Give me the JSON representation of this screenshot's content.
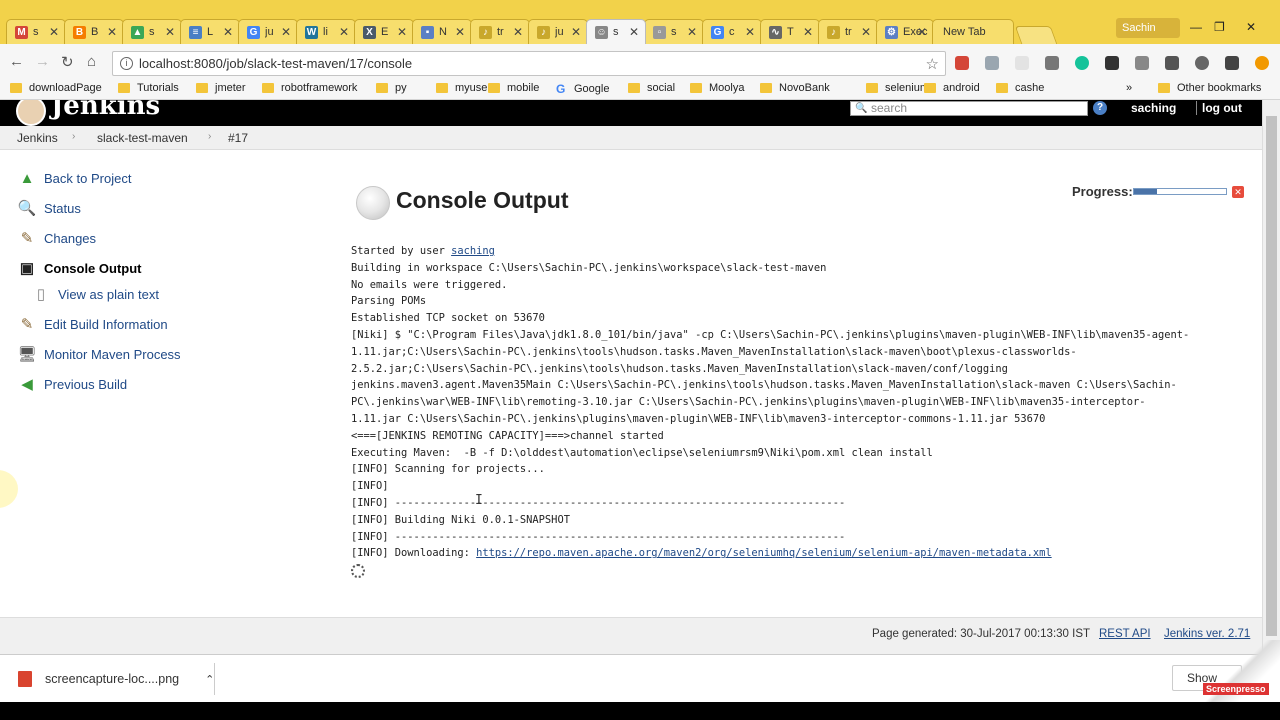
{
  "browser": {
    "tabs": [
      {
        "label": "s",
        "color": "#d44638",
        "glyph": "M"
      },
      {
        "label": "B",
        "color": "#f57d00",
        "glyph": "B"
      },
      {
        "label": "s",
        "color": "#3aa757",
        "glyph": "▲"
      },
      {
        "label": "L",
        "color": "#4a7fc4",
        "glyph": "≡"
      },
      {
        "label": "ju",
        "color": "#4285f4",
        "glyph": "G"
      },
      {
        "label": "li",
        "color": "#21759b",
        "glyph": "W"
      },
      {
        "label": "E",
        "color": "#4a5a6a",
        "glyph": "X"
      },
      {
        "label": "N",
        "color": "#5b7fc4",
        "glyph": "▪"
      },
      {
        "label": "tr",
        "color": "#c9a82c",
        "glyph": "♪"
      },
      {
        "label": "ju",
        "color": "#c9a82c",
        "glyph": "♪"
      },
      {
        "label": "s",
        "color": "#888888",
        "glyph": "☺"
      },
      {
        "label": "s",
        "color": "#999999",
        "glyph": "▫"
      },
      {
        "label": "c",
        "color": "#4285f4",
        "glyph": "G"
      },
      {
        "label": "T",
        "color": "#666666",
        "glyph": "∿"
      },
      {
        "label": "tr",
        "color": "#c9a82c",
        "glyph": "♪"
      },
      {
        "label": "Exec",
        "color": "#5b7fc4",
        "glyph": "⚙"
      }
    ],
    "new_tab_label": "New Tab",
    "profile_name": "Sachin",
    "url": "localhost:8080/job/slack-test-maven/17/console",
    "bookmarks": [
      "downloadPage",
      "Tutorials",
      "jmeter",
      "robotframework",
      "py",
      "myuse",
      "mobile",
      "Google",
      "social",
      "Moolya",
      "NovoBank",
      "selenium",
      "android",
      "cashe"
    ],
    "other_bookmarks": "Other bookmarks",
    "overflow": "»"
  },
  "jenkins": {
    "logo_text": "Jenkins",
    "search_placeholder": "search",
    "user": "saching",
    "logout": "log out",
    "breadcrumb": [
      "Jenkins",
      "slack-test-maven",
      "#17"
    ],
    "sidebar": [
      {
        "label": "Back to Project",
        "icon": "arrow-up-icon"
      },
      {
        "label": "Status",
        "icon": "magnifier-icon"
      },
      {
        "label": "Changes",
        "icon": "notepad-icon"
      },
      {
        "label": "Console Output",
        "icon": "terminal-icon"
      },
      {
        "label": "View as plain text",
        "icon": "document-icon"
      },
      {
        "label": "Edit Build Information",
        "icon": "notepad-icon"
      },
      {
        "label": "Monitor Maven Process",
        "icon": "computer-icon"
      },
      {
        "label": "Previous Build",
        "icon": "arrow-left-icon"
      }
    ],
    "title": "Console Output",
    "progress_label": "Progress:",
    "progress_value": 0.25,
    "console": {
      "started_prefix": "Started by user ",
      "started_user": "saching",
      "lines": [
        "Building in workspace C:\\Users\\Sachin-PC\\.jenkins\\workspace\\slack-test-maven",
        "No emails were triggered.",
        "Parsing POMs",
        "Established TCP socket on 53670",
        "[Niki] $ \"C:\\Program Files\\Java\\jdk1.8.0_101/bin/java\" -cp C:\\Users\\Sachin-PC\\.jenkins\\plugins\\maven-plugin\\WEB-INF\\lib\\maven35-agent-",
        "1.11.jar;C:\\Users\\Sachin-PC\\.jenkins\\tools\\hudson.tasks.Maven_MavenInstallation\\slack-maven\\boot\\plexus-classworlds-",
        "2.5.2.jar;C:\\Users\\Sachin-PC\\.jenkins\\tools\\hudson.tasks.Maven_MavenInstallation\\slack-maven/conf/logging",
        "jenkins.maven3.agent.Maven35Main C:\\Users\\Sachin-PC\\.jenkins\\tools\\hudson.tasks.Maven_MavenInstallation\\slack-maven C:\\Users\\Sachin-",
        "PC\\.jenkins\\war\\WEB-INF\\lib\\remoting-3.10.jar C:\\Users\\Sachin-PC\\.jenkins\\plugins\\maven-plugin\\WEB-INF\\lib\\maven35-interceptor-",
        "1.11.jar C:\\Users\\Sachin-PC\\.jenkins\\plugins\\maven-plugin\\WEB-INF\\lib\\maven3-interceptor-commons-1.11.jar 53670",
        "<===[JENKINS REMOTING CAPACITY]===>channel started",
        "Executing Maven:  -B -f D:\\olddest\\automation\\eclipse\\seleniumrsm9\\Niki\\pom.xml clean install",
        "[INFO] Scanning for projects...",
        "[INFO]",
        "[INFO] ------------------------------------------------------------------------",
        "[INFO] Building Niki 0.0.1-SNAPSHOT",
        "[INFO] ------------------------------------------------------------------------"
      ],
      "download_prefix": "[INFO] Downloading: ",
      "download_url": "https://repo.maven.apache.org/maven2/org/seleniumhq/selenium/selenium-api/maven-metadata.xml"
    },
    "footer": {
      "generated": "Page generated: 30-Jul-2017 00:13:30 IST",
      "rest_api": "REST API",
      "version": "Jenkins ver. 2.71"
    }
  },
  "downloads": {
    "file": "screencapture-loc....png",
    "show_all": "Show",
    "watermark": "Screenpresso"
  }
}
